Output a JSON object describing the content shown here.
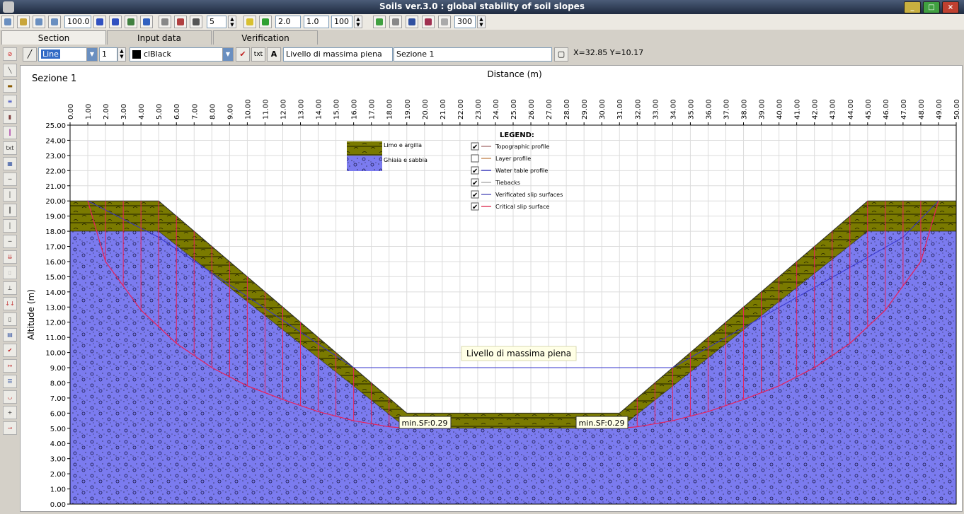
{
  "window": {
    "title": "Soils ver.3.0 : global stability of soil slopes"
  },
  "toolbar": {
    "zoom": "100.0",
    "ticks": "5",
    "width_x": "2.0",
    "width_y": "1.0",
    "scale": "100",
    "resolution": "300"
  },
  "tabs": [
    {
      "label": "Section",
      "active": true
    },
    {
      "label": "Input data",
      "active": false
    },
    {
      "label": "Verification",
      "active": false
    }
  ],
  "options": {
    "line_type": "Line",
    "line_width": "1",
    "color_name": "clBlack",
    "text_button": "txt",
    "font_button": "A",
    "label_text": "Livello di massima piena",
    "section_name": "Sezione 1",
    "coords": "X=32.85 Y=10.17"
  },
  "plot": {
    "section_title": "Sezione 1",
    "xlabel": "Distance (m)",
    "ylabel": "Altitude (m)",
    "water_label": "Livello di massima piena",
    "sf_labels": [
      "min.SF:0.29",
      "min.SF:0.29"
    ],
    "materials": [
      {
        "name": "Limo e argilla",
        "color": "#7a7a00"
      },
      {
        "name": "Ghiaia e sabbia",
        "color": "#7b7bef"
      }
    ],
    "legend_title": "LEGEND:",
    "legend": [
      {
        "label": "Topographic profile",
        "checked": true,
        "color": "#b08080"
      },
      {
        "label": "Layer profile",
        "checked": false,
        "color": "#c89060"
      },
      {
        "label": "Water table profile",
        "checked": true,
        "color": "#4040c0"
      },
      {
        "label": "Tiebacks",
        "checked": true,
        "color": "#b0b0b0"
      },
      {
        "label": "Verificated slip surfaces",
        "checked": true,
        "color": "#6060c0"
      },
      {
        "label": "Critical slip surface",
        "checked": true,
        "color": "#e04060"
      }
    ]
  },
  "chart_data": {
    "type": "line",
    "xlabel": "Distance (m)",
    "ylabel": "Altitude (m)",
    "xlim": [
      0,
      50
    ],
    "ylim": [
      0,
      25
    ],
    "xtick_step": 1,
    "ytick_step": 1,
    "grid": true,
    "series": [
      {
        "name": "Topographic profile",
        "x": [
          0,
          5,
          19,
          31,
          45,
          50
        ],
        "y": [
          20,
          20,
          6,
          6,
          20,
          20
        ]
      },
      {
        "name": "Layer profile",
        "x": [
          0,
          5,
          19,
          31,
          45,
          50
        ],
        "y": [
          18,
          18,
          5,
          5,
          18,
          18
        ]
      },
      {
        "name": "Water table profile",
        "x": [
          1,
          5,
          16,
          34,
          47,
          49
        ],
        "y": [
          20,
          17.6,
          9,
          9,
          17.6,
          20
        ]
      },
      {
        "name": "Critical slip surface",
        "x": [
          1,
          2,
          4,
          6,
          8,
          10,
          12,
          14,
          16,
          18,
          19
        ],
        "y": [
          20,
          16,
          12.8,
          10.6,
          9,
          7.8,
          6.9,
          6.1,
          5.5,
          5.1,
          5.0
        ]
      },
      {
        "name": "Critical slip surface",
        "x": [
          31,
          32,
          34,
          36,
          38,
          40,
          42,
          44,
          46,
          48,
          49
        ],
        "y": [
          5.0,
          5.1,
          5.5,
          6.1,
          6.9,
          7.8,
          9,
          10.6,
          12.8,
          16,
          20
        ]
      }
    ],
    "annotations": [
      "Livello di massima piena",
      "min.SF:0.29",
      "min.SF:0.29"
    ]
  }
}
